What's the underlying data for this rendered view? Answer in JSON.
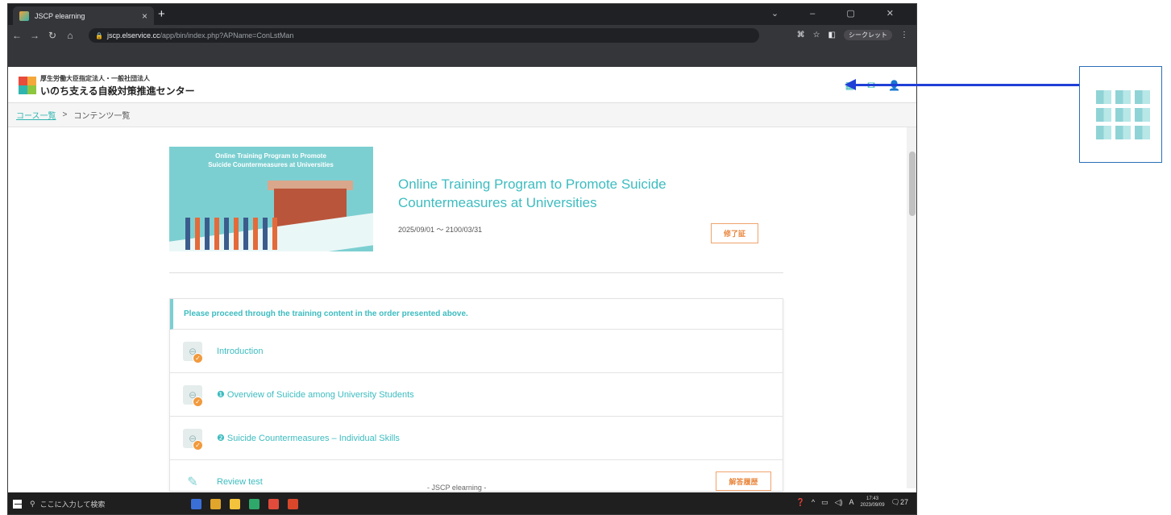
{
  "browser": {
    "tab_title": "JSCP elearning",
    "url_host": "jscp.elservice.cc",
    "url_path": "/app/bin/index.php?APName=ConLstMan",
    "profile_label": "シークレット"
  },
  "site": {
    "org_line1": "厚生労働大臣指定法人・一般社団法人",
    "org_line2": "いのち支える自殺対策推進センター"
  },
  "breadcrumb": {
    "link": "コース一覧",
    "separator": ">",
    "current": "コンテンツ一覧"
  },
  "course": {
    "banner_title": "Online Training Program to Promote\nSuicide Countermeasures at Universities",
    "title": "Online Training Program to Promote Suicide Countermeasures at Universities",
    "period": "2025/09/01 〜 2100/03/31",
    "certificate_label": "修了証"
  },
  "contents": {
    "notice": "Please proceed through the training content in the order presented above.",
    "items": [
      {
        "label": "Introduction",
        "status": "completed"
      },
      {
        "label": "❶ Overview of Suicide among University Students",
        "status": "completed"
      },
      {
        "label": "❷ Suicide Countermeasures – Individual Skills",
        "status": "completed"
      },
      {
        "label": "Review test",
        "history_label": "解答履歴"
      }
    ]
  },
  "footer": "- JSCP elearning -",
  "taskbar": {
    "search_placeholder": "ここに入力して検索",
    "time": "17:43",
    "date": "2023/09/09",
    "notification_count": "27"
  }
}
